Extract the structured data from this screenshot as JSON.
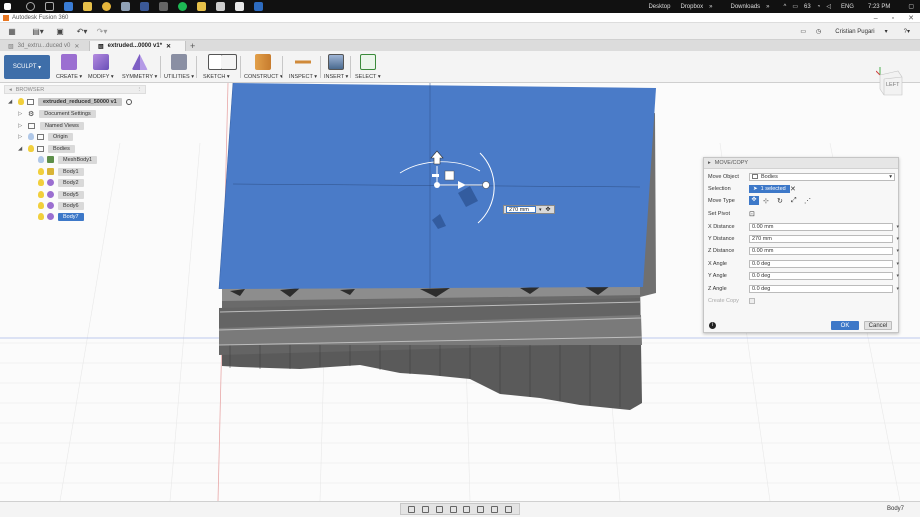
{
  "taskbar": {
    "items": [
      "Desktop",
      "Dropbox",
      "Downloads"
    ],
    "language": "ENG",
    "time": "7:23 PM",
    "battery": "63"
  },
  "app": {
    "title": "Autodesk Fusion 360",
    "user": "Cristian Pugari"
  },
  "tabs": [
    {
      "label": "3d_extru...duced v0"
    },
    {
      "label": "extruded...0000 v1*"
    }
  ],
  "toolbar": {
    "workspace": "SCULPT",
    "tools": [
      {
        "label": "CREATE",
        "icon": "create-icon"
      },
      {
        "label": "MODIFY",
        "icon": "modify-icon"
      },
      {
        "label": "SYMMETRY",
        "icon": "symmetry-icon"
      },
      {
        "label": "UTILITIES",
        "icon": "utilities-icon"
      },
      {
        "label": "SKETCH",
        "icon": "sketch-icon"
      },
      {
        "label": "CONSTRUCT",
        "icon": "construct-icon"
      },
      {
        "label": "INSPECT",
        "icon": "inspect-icon"
      },
      {
        "label": "INSERT",
        "icon": "insert-icon"
      },
      {
        "label": "SELECT",
        "icon": "select-icon"
      }
    ]
  },
  "browser": {
    "header": "BROWSER",
    "root": "extruded_reduced_50000 v1",
    "items": [
      {
        "label": "Document Settings"
      },
      {
        "label": "Named Views"
      },
      {
        "label": "Origin"
      },
      {
        "label": "Bodies"
      },
      {
        "label": "MeshBody1"
      },
      {
        "label": "Body1"
      },
      {
        "label": "Body2"
      },
      {
        "label": "Body5"
      },
      {
        "label": "Body6"
      },
      {
        "label": "Body7"
      }
    ]
  },
  "viewcube": {
    "face": "LEFT"
  },
  "manipulator": {
    "value": "270 mm"
  },
  "dialog": {
    "title": "MOVE/COPY",
    "move_object_label": "Move Object",
    "move_object_value": "Bodies",
    "selection_label": "Selection",
    "selection_value": "1 selected",
    "move_type_label": "Move Type",
    "set_pivot_label": "Set Pivot",
    "fields": [
      {
        "label": "X Distance",
        "value": "0.00 mm"
      },
      {
        "label": "Y Distance",
        "value": "270 mm"
      },
      {
        "label": "Z Distance",
        "value": "0.00 mm"
      },
      {
        "label": "X Angle",
        "value": "0.0 deg"
      },
      {
        "label": "Y Angle",
        "value": "0.0 deg"
      },
      {
        "label": "Z Angle",
        "value": "0.0 deg"
      }
    ],
    "create_copy_label": "Create Copy",
    "ok_label": "OK",
    "cancel_label": "Cancel"
  },
  "status": {
    "selection": "Body7"
  },
  "colors": {
    "accent": "#3e6ea9",
    "body_blue": "#4a7bc8",
    "selected_blue": "#3d78c8"
  }
}
